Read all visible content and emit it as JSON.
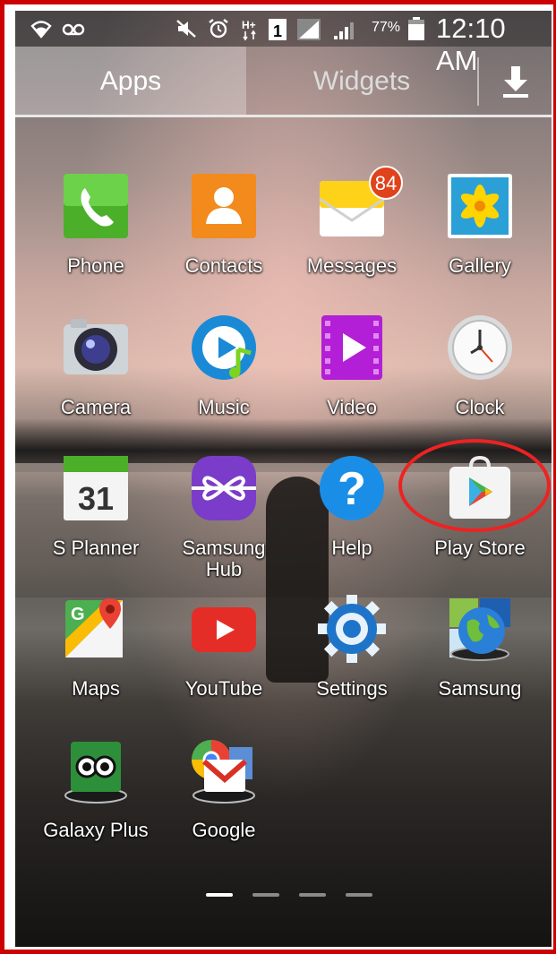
{
  "status_bar": {
    "battery_percent": "77%",
    "time": "12:10 AM",
    "icons": [
      "wifi-icon",
      "voicemail-icon",
      "mute-icon",
      "alarm-icon",
      "hplus-data-icon",
      "sim-icon",
      "signal-icon",
      "battery-icon"
    ]
  },
  "tabs": {
    "apps": "Apps",
    "widgets": "Widgets",
    "download_icon": "download-icon"
  },
  "apps": [
    {
      "label": "Phone",
      "icon": "phone-icon"
    },
    {
      "label": "Contacts",
      "icon": "contacts-icon"
    },
    {
      "label": "Messages",
      "icon": "messages-icon",
      "badge": "84"
    },
    {
      "label": "Gallery",
      "icon": "gallery-icon"
    },
    {
      "label": "Camera",
      "icon": "camera-icon"
    },
    {
      "label": "Music",
      "icon": "music-icon"
    },
    {
      "label": "Video",
      "icon": "video-icon"
    },
    {
      "label": "Clock",
      "icon": "clock-icon"
    },
    {
      "label": "S Planner",
      "icon": "calendar-icon",
      "date": "31"
    },
    {
      "label": "Samsung Hub",
      "icon": "samsung-hub-icon"
    },
    {
      "label": "Help",
      "icon": "help-icon"
    },
    {
      "label": "Play Store",
      "icon": "play-store-icon"
    },
    {
      "label": "Maps",
      "icon": "maps-icon"
    },
    {
      "label": "YouTube",
      "icon": "youtube-icon"
    },
    {
      "label": "Settings",
      "icon": "settings-icon"
    },
    {
      "label": "Samsung",
      "icon": "samsung-globe-icon"
    },
    {
      "label": "Galaxy Plus",
      "icon": "tripadvisor-icon"
    },
    {
      "label": "Google",
      "icon": "google-folder-icon"
    }
  ],
  "pager": {
    "pages": 4,
    "current": 1
  },
  "colors": {
    "highlight": "#e22222",
    "frame": "#cc0000"
  }
}
